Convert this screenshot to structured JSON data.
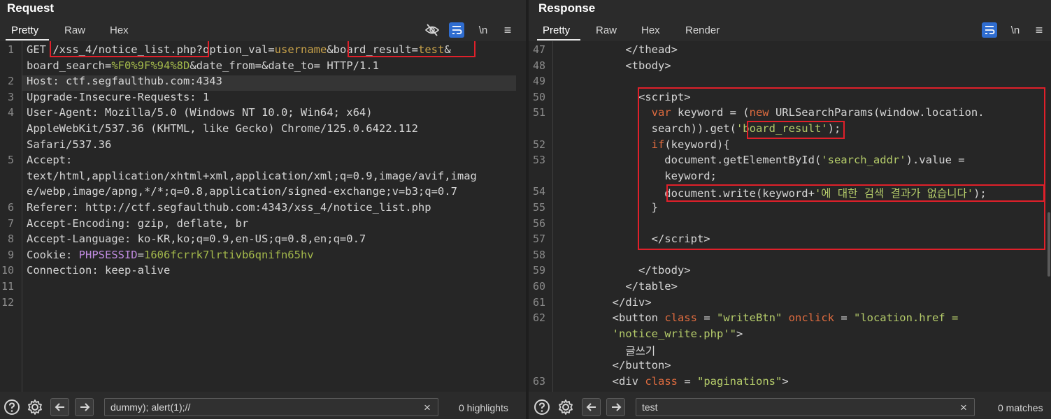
{
  "request": {
    "title": "Request",
    "tabs": [
      "Pretty",
      "Raw",
      "Hex"
    ],
    "active_tab": "Pretty",
    "lines": [
      {
        "n": "1",
        "html": "GET <span class=\"k\">/xss_4/notice_list.php</span>?<span class=\"k\">option_val</span>=<span class=\"v\">username</span>&amp;<span class=\"k\">board_result</span>=<span class=\"v\">test</span>&amp;"
      },
      {
        "n": "",
        "html": "<span class=\"k\">board_search</span>=<span class=\"g\">%F0%9F%94%8D</span>&amp;<span class=\"k\">date_from</span>=&amp;<span class=\"k\">date_to</span>= HTTP/1.1"
      },
      {
        "n": "2",
        "html": "Host: ctf.segfaulthub.com:4343"
      },
      {
        "n": "3",
        "html": "Upgrade-Insecure-Requests: 1"
      },
      {
        "n": "4",
        "html": "User-Agent: Mozilla/5.0 (Windows NT 10.0; Win64; x64)"
      },
      {
        "n": "",
        "html": "AppleWebKit/537.36 (KHTML, like Gecko) Chrome/125.0.6422.112"
      },
      {
        "n": "",
        "html": "Safari/537.36"
      },
      {
        "n": "5",
        "html": "Accept:"
      },
      {
        "n": "",
        "html": "text/html,application/xhtml+xml,application/xml;q=0.9,image/avif,imag"
      },
      {
        "n": "",
        "html": "e/webp,image/apng,*/*;q=0.8,application/signed-exchange;v=b3;q=0.7"
      },
      {
        "n": "6",
        "html": "Referer: http://ctf.segfaulthub.com:4343/xss_4/notice_list.php"
      },
      {
        "n": "7",
        "html": "Accept-Encoding: gzip, deflate, br"
      },
      {
        "n": "8",
        "html": "Accept-Language: ko-KR,ko;q=0.9,en-US;q=0.8,en;q=0.7"
      },
      {
        "n": "9",
        "html": "Cookie: <span class=\"u\">PHPSESSID</span>=<span class=\"g\">1606fcrrk7lrtivb6qnifn65hv</span>"
      },
      {
        "n": "10",
        "html": "Connection: keep-alive"
      },
      {
        "n": "11",
        "html": ""
      },
      {
        "n": "12",
        "html": ""
      }
    ],
    "search_value": "dummy); alert(1);//",
    "count_label": "0 highlights"
  },
  "response": {
    "title": "Response",
    "tabs": [
      "Pretty",
      "Raw",
      "Hex",
      "Render"
    ],
    "active_tab": "Pretty",
    "lines": [
      {
        "n": "47",
        "html": "          &lt;/thead&gt;"
      },
      {
        "n": "48",
        "html": "          &lt;tbody&gt;"
      },
      {
        "n": "49",
        "html": ""
      },
      {
        "n": "50",
        "html": "            &lt;script&gt;"
      },
      {
        "n": "51",
        "html": "              <span class=\"kw\">var</span> keyword = (<span class=\"kw\">new</span> URLSearchParams(window.location."
      },
      {
        "n": "",
        "html": "              search)).get(<span class=\"str\">'board_result'</span>);"
      },
      {
        "n": "52",
        "html": "              <span class=\"kw\">if</span>(keyword){"
      },
      {
        "n": "53",
        "html": "                document.getElementById(<span class=\"str\">'search_addr'</span>).value ="
      },
      {
        "n": "",
        "html": "                keyword;"
      },
      {
        "n": "54",
        "html": "                document.write(keyword+<span class=\"str\">'에 대한 검색 결과가 없습니다'</span>);"
      },
      {
        "n": "55",
        "html": "              }"
      },
      {
        "n": "56",
        "html": ""
      },
      {
        "n": "57",
        "html": "              &lt;/script&gt;"
      },
      {
        "n": "58",
        "html": ""
      },
      {
        "n": "59",
        "html": "            &lt;/tbody&gt;"
      },
      {
        "n": "60",
        "html": "          &lt;/table&gt;"
      },
      {
        "n": "61",
        "html": "        &lt;/div&gt;"
      },
      {
        "n": "62",
        "html": "        &lt;button <span class=\"kw\">class</span> = <span class=\"str\">\"writeBtn\"</span> <span class=\"kw\">onclick</span> = <span class=\"str\">\"location.href =</span>"
      },
      {
        "n": "",
        "html": "        <span class=\"str\">'notice_write.php'\"</span>&gt;"
      },
      {
        "n": "",
        "html": "          글쓰기"
      },
      {
        "n": "",
        "html": "        &lt;/button&gt;"
      },
      {
        "n": "63",
        "html": "        &lt;div <span class=\"kw\">class</span> = <span class=\"str\">\"paginations\"</span>&gt;"
      }
    ],
    "search_value": "test",
    "count_label": "0 matches"
  },
  "icons": {
    "help": "help-icon",
    "settings": "gear-icon",
    "back": "arrow-left-icon",
    "forward": "arrow-right-icon",
    "clear": "×",
    "newline": "\\n",
    "menu": "≡"
  },
  "colors": {
    "accent": "#2f6dd0",
    "highlight_box": "#e0202a"
  }
}
